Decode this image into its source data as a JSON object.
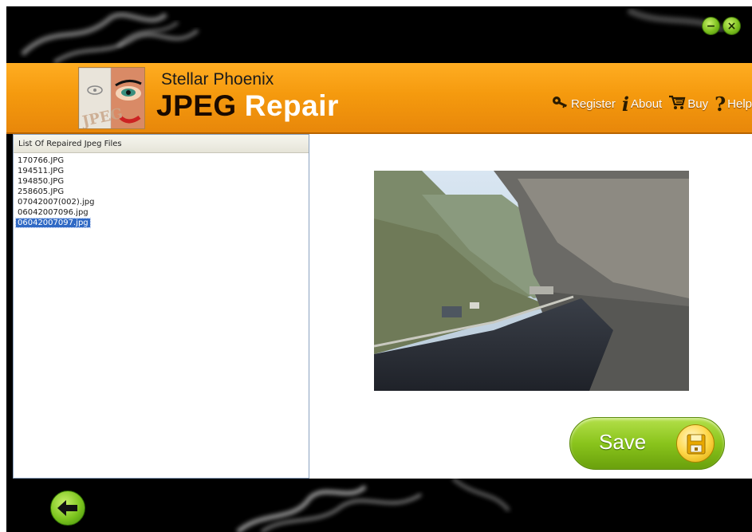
{
  "window_controls": {
    "minimize_symbol": "−",
    "close_symbol": "×"
  },
  "header": {
    "brand_top": "Stellar Phoenix",
    "brand_main": "JPEG",
    "brand_sub": "Repair",
    "logo_text": "JPEG",
    "menu": [
      {
        "label": "Register",
        "icon": "key-icon"
      },
      {
        "label": "About",
        "icon": "info-icon"
      },
      {
        "label": "Buy",
        "icon": "cart-icon"
      },
      {
        "label": "Help",
        "icon": "help-icon"
      }
    ]
  },
  "file_panel": {
    "title": "List Of Repaired Jpeg Files",
    "files": [
      "170766.JPG",
      "194511.JPG",
      "194850.JPG",
      "258605.JPG",
      "07042007(002).jpg",
      "06042007096.jpg",
      "06042007097.jpg"
    ],
    "selected_index": 6
  },
  "preview": {
    "save_label": "Save"
  },
  "colors": {
    "header_orange": "#f59a0e",
    "button_green": "#8ac41c",
    "selection_blue": "#316ac5"
  }
}
